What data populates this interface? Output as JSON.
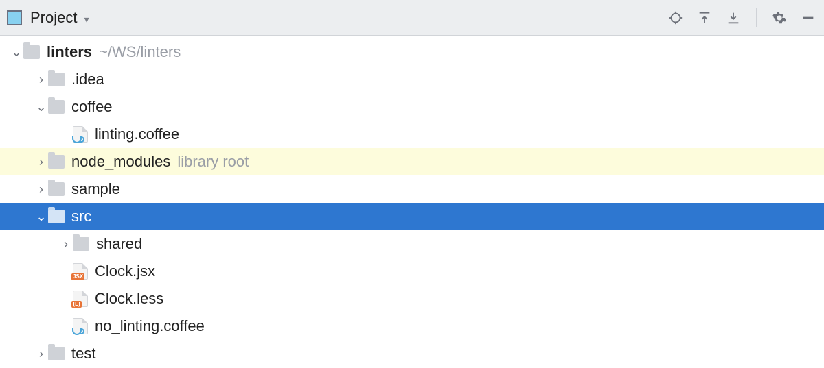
{
  "toolbar": {
    "title": "Project"
  },
  "tree": {
    "root": {
      "name": "linters",
      "path_hint": "~/WS/linters"
    },
    "idea": {
      "name": ".idea"
    },
    "coffee": {
      "name": "coffee"
    },
    "linting_coffee": {
      "name": "linting.coffee"
    },
    "node_modules": {
      "name": "node_modules",
      "hint": "library root"
    },
    "sample": {
      "name": "sample"
    },
    "src": {
      "name": "src"
    },
    "shared": {
      "name": "shared"
    },
    "clock_jsx": {
      "name": "Clock.jsx"
    },
    "clock_less": {
      "name": "Clock.less"
    },
    "no_linting_coffee": {
      "name": "no_linting.coffee"
    },
    "test": {
      "name": "test"
    }
  }
}
